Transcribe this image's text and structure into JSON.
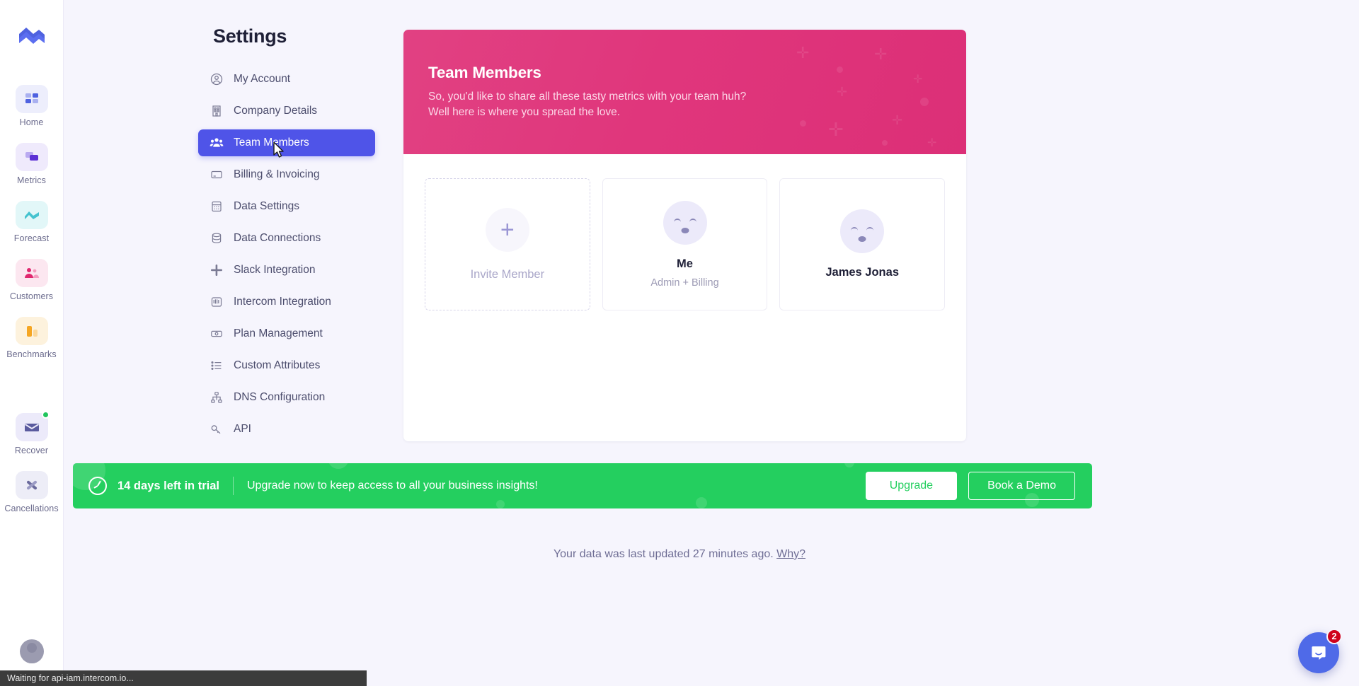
{
  "rail": {
    "logo_icon": "baremetrics-logo-icon",
    "items": [
      {
        "label": "Home",
        "icon": "grid-icon",
        "badge": false
      },
      {
        "label": "Metrics",
        "icon": "layers-icon",
        "badge": false
      },
      {
        "label": "Forecast",
        "icon": "wave-chart-icon",
        "badge": false
      },
      {
        "label": "Customers",
        "icon": "people-icon",
        "badge": false
      },
      {
        "label": "Benchmarks",
        "icon": "bar-chart-icon",
        "badge": false
      },
      {
        "label": "Recover",
        "icon": "envelope-icon",
        "badge": true
      },
      {
        "label": "Cancellations",
        "icon": "cross-swords-icon",
        "badge": false
      }
    ]
  },
  "settings": {
    "title": "Settings",
    "items": [
      {
        "label": "My Account",
        "icon": "user-circle-icon",
        "active": false
      },
      {
        "label": "Company Details",
        "icon": "building-icon",
        "active": false
      },
      {
        "label": "Team Members",
        "icon": "group-icon",
        "active": true
      },
      {
        "label": "Billing & Invoicing",
        "icon": "card-icon",
        "active": false
      },
      {
        "label": "Data Settings",
        "icon": "calculator-icon",
        "active": false
      },
      {
        "label": "Data Connections",
        "icon": "database-icon",
        "active": false
      },
      {
        "label": "Slack Integration",
        "icon": "slack-icon",
        "active": false
      },
      {
        "label": "Intercom Integration",
        "icon": "intercom-icon",
        "active": false
      },
      {
        "label": "Plan Management",
        "icon": "banknote-icon",
        "active": false
      },
      {
        "label": "Custom Attributes",
        "icon": "list-icon",
        "active": false
      },
      {
        "label": "DNS Configuration",
        "icon": "sitemap-icon",
        "active": false
      },
      {
        "label": "API",
        "icon": "key-icon",
        "active": false
      }
    ]
  },
  "hero": {
    "title": "Team Members",
    "line1": "So, you'd like to share all these tasty metrics with your team huh?",
    "line2": "Well here is where you spread the love.",
    "color": "#de3279"
  },
  "members": {
    "invite": {
      "label": "Invite Member",
      "icon": "plus-icon"
    },
    "cards": [
      {
        "name": "Me",
        "role": "Admin + Billing",
        "avatar": "smiley-avatar"
      },
      {
        "name": "James Jonas",
        "role": "",
        "avatar": "smiley-avatar"
      }
    ]
  },
  "trial": {
    "icon": "clock-icon",
    "days_text": "14 days left in trial",
    "message": "Upgrade now to keep access to all your business insights!",
    "upgrade_label": "Upgrade",
    "demo_label": "Book a Demo",
    "color": "#24cf5f"
  },
  "footer": {
    "text": "Your data was last updated 27 minutes ago.",
    "link": "Why?"
  },
  "intercom": {
    "icon": "chat-bubble-icon",
    "badge": "2",
    "color": "#4f6ae8"
  },
  "statusbar": {
    "text": "Waiting for api-iam.intercom.io..."
  }
}
